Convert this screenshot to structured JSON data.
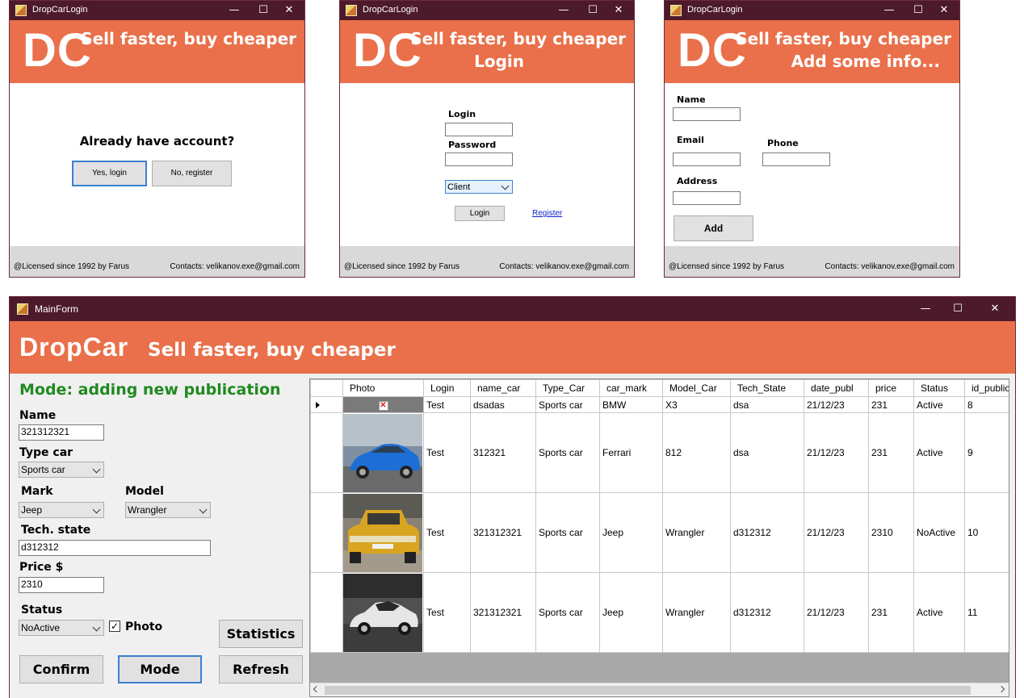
{
  "login_windows": {
    "title": "DropCarLogin",
    "logo": "DC",
    "slogan": "Sell faster, buy cheaper",
    "footer_left": "@Licensed since 1992 by Farus",
    "footer_right": "Contacts: velikanov.exe@gmail.com",
    "controls": {
      "minimize": "—",
      "maximize": "☐",
      "close": "✕"
    }
  },
  "start_screen": {
    "question": "Already have account?",
    "yes_button": "Yes, login",
    "no_button": "No, register"
  },
  "login_screen": {
    "subtitle": "Login",
    "login_label": "Login",
    "login_value": "",
    "password_label": "Password",
    "password_value": "",
    "role_selected": "Client",
    "login_button": "Login",
    "register_link": "Register"
  },
  "info_screen": {
    "subtitle": "Add some info...",
    "name_label": "Name",
    "name_value": "",
    "email_label": "Email",
    "email_value": "",
    "phone_label": "Phone",
    "phone_value": "",
    "address_label": "Address",
    "address_value": "",
    "add_button": "Add"
  },
  "main_form": {
    "title": "MainForm",
    "logo": "DropCar",
    "slogan": "Sell faster, buy cheaper",
    "mode_text": "Mode: adding new publication",
    "mode_color": "#1f8a1f",
    "name_label": "Name",
    "name_value": "321312321",
    "type_label": "Type car",
    "type_value": "Sports car",
    "mark_label": "Mark",
    "mark_value": "Jeep",
    "model_label": "Model",
    "model_value": "Wrangler",
    "tech_label": "Tech. state",
    "tech_value": "d312312",
    "price_label": "Price $",
    "price_value": "2310",
    "status_label": "Status",
    "status_value": "NoActive",
    "photo_checkbox_label": "Photo",
    "photo_checked": true,
    "statistics_button": "Statistics",
    "confirm_button": "Confirm",
    "mode_button": "Mode",
    "refresh_button": "Refresh",
    "columns": [
      "Photo",
      "Login",
      "name_car",
      "Type_Car",
      "car_mark",
      "Model_Car",
      "Tech_State",
      "date_publ",
      "price",
      "Status",
      "id_publica"
    ],
    "rows": [
      {
        "photo": "missing",
        "login": "Test",
        "name_car": "dsadas",
        "type_car": "Sports car",
        "car_mark": "BMW",
        "model_car": "X3",
        "tech_state": "dsa",
        "date_publ": "21/12/23",
        "price": "231",
        "status": "Active",
        "id": "8",
        "current": true
      },
      {
        "photo": "blue-car",
        "login": "Test",
        "name_car": "312321",
        "type_car": "Sports car",
        "car_mark": "Ferrari",
        "model_car": "812",
        "tech_state": "dsa",
        "date_publ": "21/12/23",
        "price": "231",
        "status": "Active",
        "id": "9",
        "current": false
      },
      {
        "photo": "yellow-car",
        "login": "Test",
        "name_car": "321312321",
        "type_car": "Sports car",
        "car_mark": "Jeep",
        "model_car": "Wrangler",
        "tech_state": "d312312",
        "date_publ": "21/12/23",
        "price": "2310",
        "status": "NoActive",
        "id": "10",
        "current": false
      },
      {
        "photo": "white-car",
        "login": "Test",
        "name_car": "321312321",
        "type_car": "Sports car",
        "car_mark": "Jeep",
        "model_car": "Wrangler",
        "tech_state": "d312312",
        "date_publ": "21/12/23",
        "price": "231",
        "status": "Active",
        "id": "11",
        "current": false
      }
    ]
  }
}
